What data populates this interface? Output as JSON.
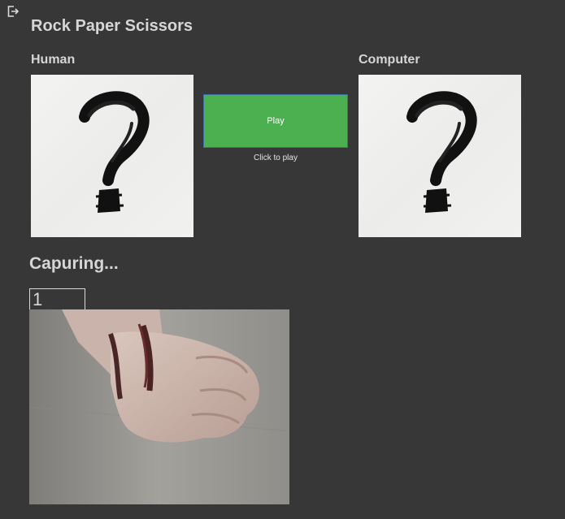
{
  "app": {
    "title": "Rock Paper Scissors"
  },
  "players": {
    "human": {
      "label": "Human",
      "choice_icon": "question-mark-icon"
    },
    "computer": {
      "label": "Computer",
      "choice_icon": "question-mark-icon"
    }
  },
  "controls": {
    "play_label": "Play",
    "play_hint": "Click to play",
    "play_color": "#4caf50"
  },
  "capture": {
    "status": "Capuring...",
    "countdown": "1",
    "feed_subject": "fist"
  },
  "toolbar": {
    "exit_icon": "exit-icon"
  },
  "colors": {
    "background": "#373737",
    "text": "#d6d6d6"
  }
}
